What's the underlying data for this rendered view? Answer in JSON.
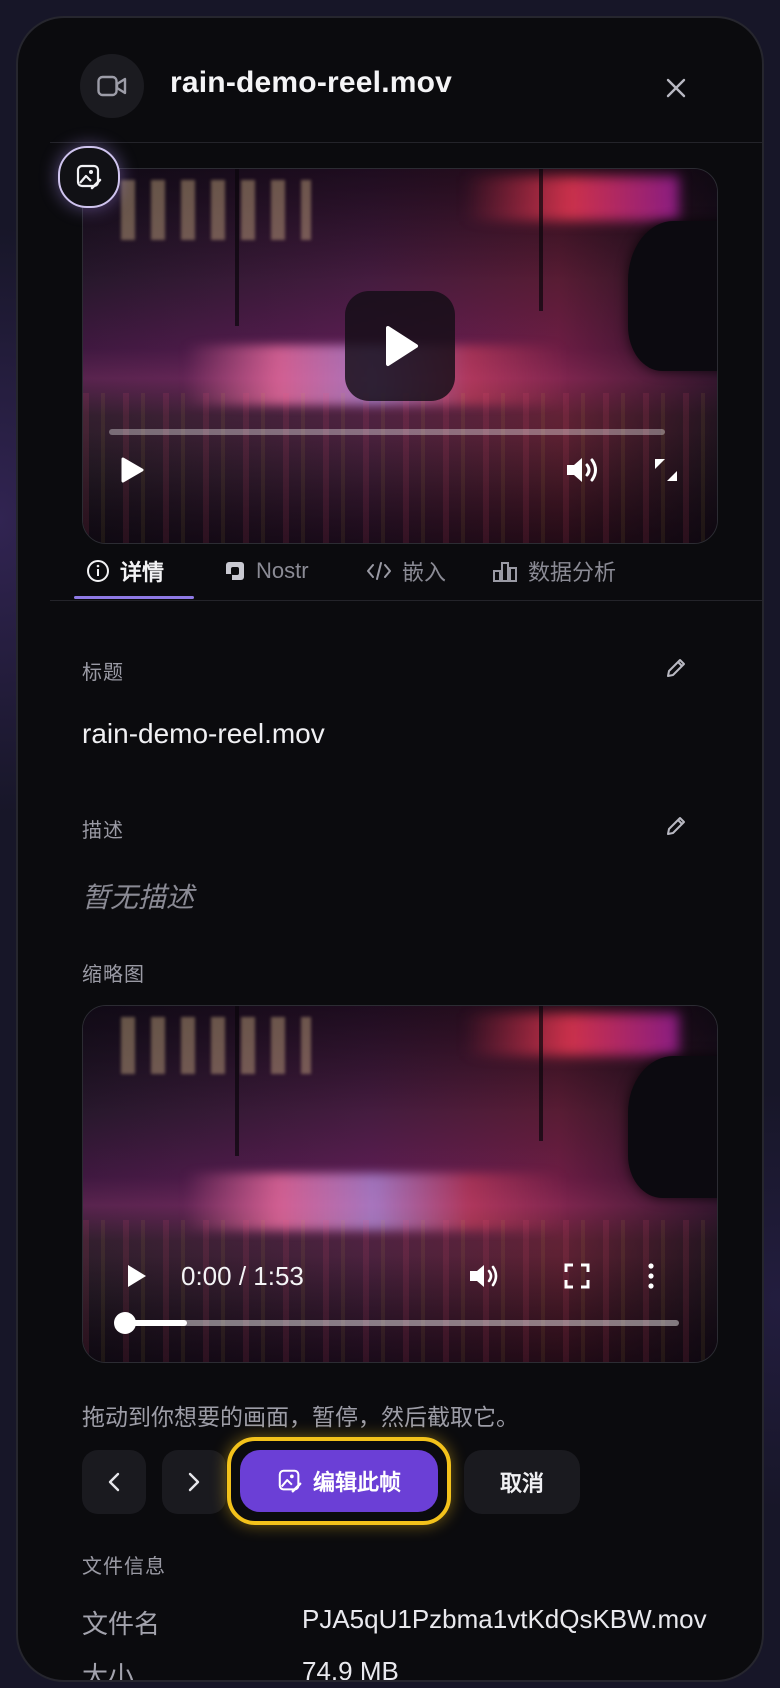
{
  "header": {
    "title": "rain-demo-reel.mov"
  },
  "player": {
    "progress": 0
  },
  "tabs": [
    {
      "label": "详情",
      "active": true
    },
    {
      "label": "Nostr",
      "active": false
    },
    {
      "label": "嵌入",
      "active": false
    },
    {
      "label": "数据分析",
      "active": false
    }
  ],
  "details": {
    "title_label": "标题",
    "title_value": "rain-demo-reel.mov",
    "description_label": "描述",
    "description_placeholder": "暂无描述",
    "thumbnail_label": "缩略图"
  },
  "thumbnail_player": {
    "time": "0:00 / 1:53",
    "progress": 0
  },
  "hint": "拖动到你想要的画面，暂停，然后截取它。",
  "actions": {
    "edit_frame_label": "编辑此帧",
    "cancel_label": "取消"
  },
  "file_info": {
    "section_label": "文件信息",
    "rows": [
      {
        "key": "文件名",
        "value": "PJA5qU1Pzbma1vtKdQsKBW.mov"
      },
      {
        "key": "大小",
        "value": "74.9 MB"
      }
    ]
  },
  "colors": {
    "accent": "#6b3fd6",
    "highlight": "#f3c21b",
    "tab_underline": "#8f7ae6"
  }
}
